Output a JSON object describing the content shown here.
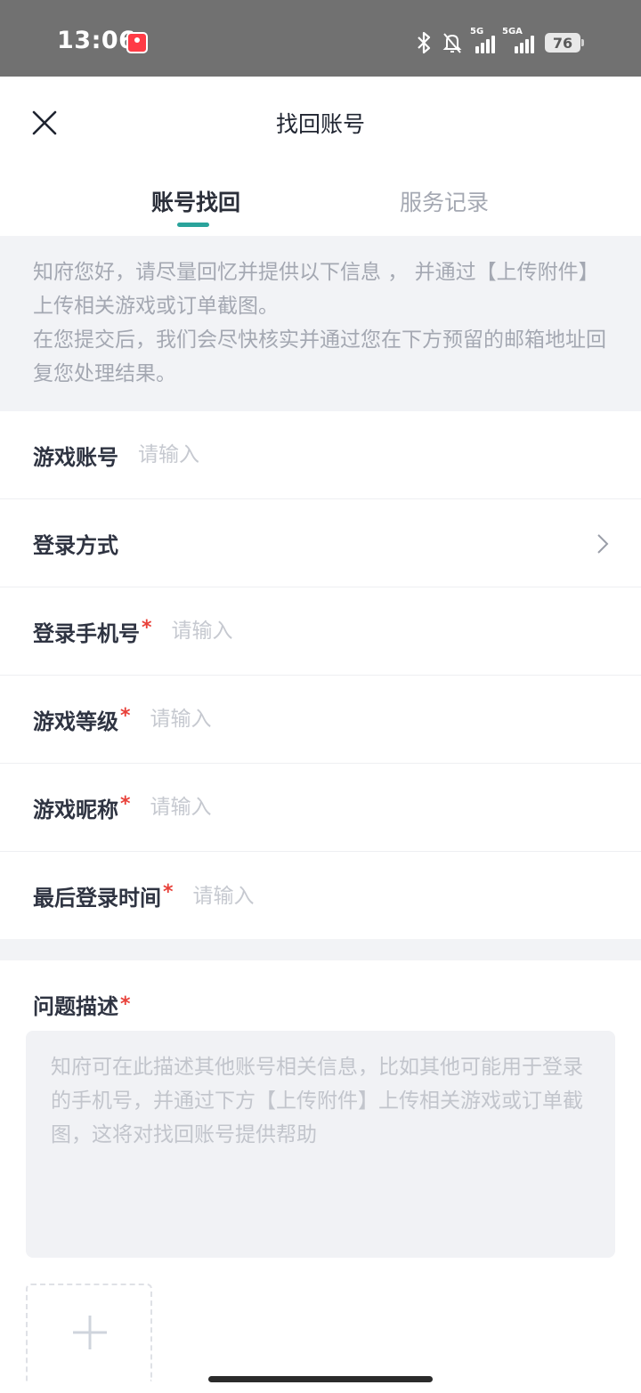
{
  "status_bar": {
    "time": "13:06",
    "network1": "5G",
    "network2": "5GA",
    "battery": "76",
    "icons": [
      "bluetooth-icon",
      "mute-icon",
      "signal-icon",
      "battery-icon"
    ]
  },
  "header": {
    "title": "找回账号",
    "close_icon": "close-icon"
  },
  "tabs": [
    {
      "label": "账号找回",
      "active": true
    },
    {
      "label": "服务记录",
      "active": false
    }
  ],
  "notice": {
    "line1": "知府您好，请尽量回忆并提供以下信息 ， 并通过【上传附件】上传相关游戏或订单截图。",
    "line2": "在您提交后，我们会尽快核实并通过您在下方预留的邮箱地址回复您处理结果。"
  },
  "form": {
    "required_mark": "*",
    "fields": [
      {
        "label": "游戏账号",
        "placeholder": "请输入",
        "required": false
      },
      {
        "label": "登录方式",
        "placeholder": "",
        "required": false
      },
      {
        "label": "登录手机号",
        "placeholder": "请输入",
        "required": true
      },
      {
        "label": "游戏等级",
        "placeholder": "请输入",
        "required": true
      },
      {
        "label": "游戏昵称",
        "placeholder": "请输入",
        "required": true
      },
      {
        "label": "最后登录时间",
        "placeholder": "请输入",
        "required": true
      }
    ]
  },
  "description": {
    "label": "问题描述",
    "placeholder": "知府可在此描述其他账号相关信息，比如其他可能用于登录的手机号，并通过下方【上传附件】上传相关游戏或订单截图，这将对找回账号提供帮助"
  },
  "colors": {
    "accent": "#2aa39b",
    "required": "#e8413a",
    "status_bar_bg": "#717171",
    "notice_bg": "#f2f3f6"
  }
}
